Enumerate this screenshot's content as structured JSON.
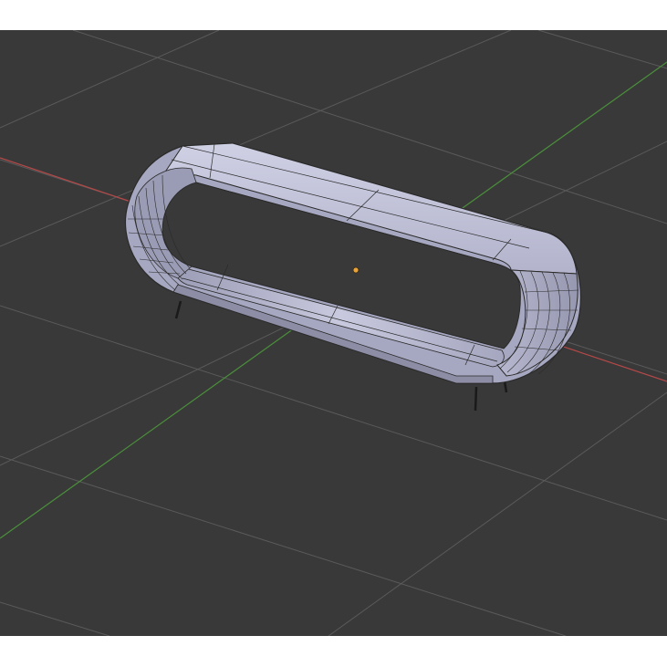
{
  "viewport": {
    "background": "#393939",
    "grid_color": "#5a5a5a",
    "x_axis_color": "#b54848",
    "y_axis_color": "#4a8f3a"
  },
  "object": {
    "origin_color": "#e8a33a",
    "wire_color": "#2a2a2a",
    "face_light": "#c5c6dc",
    "face_mid": "#a9aac3",
    "face_dark": "#8d8ea6",
    "leg_color": "#1a1a1a"
  }
}
